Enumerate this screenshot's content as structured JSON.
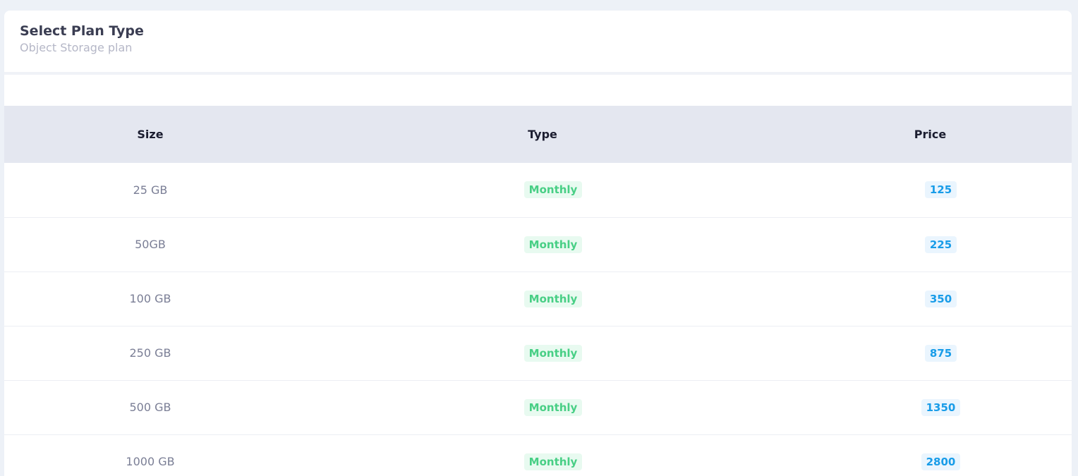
{
  "header": {
    "title": "Select Plan Type",
    "subtitle": "Object Storage plan"
  },
  "table": {
    "columns": [
      "Size",
      "Type",
      "Price"
    ],
    "rows": [
      {
        "size": "25 GB",
        "type": "Monthly",
        "price": "125"
      },
      {
        "size": "50GB",
        "type": "Monthly",
        "price": "225"
      },
      {
        "size": "100 GB",
        "type": "Monthly",
        "price": "350"
      },
      {
        "size": "250 GB",
        "type": "Monthly",
        "price": "875"
      },
      {
        "size": "500 GB",
        "type": "Monthly",
        "price": "1350"
      },
      {
        "size": "1000 GB",
        "type": "Monthly",
        "price": "2800"
      }
    ]
  },
  "colors": {
    "type_badge_text": "#48cf85",
    "type_badge_bg": "#e8faf0",
    "price_badge_text": "#189ce8",
    "price_badge_bg": "#eaf5fe",
    "header_row_bg": "#e4e7f0"
  }
}
